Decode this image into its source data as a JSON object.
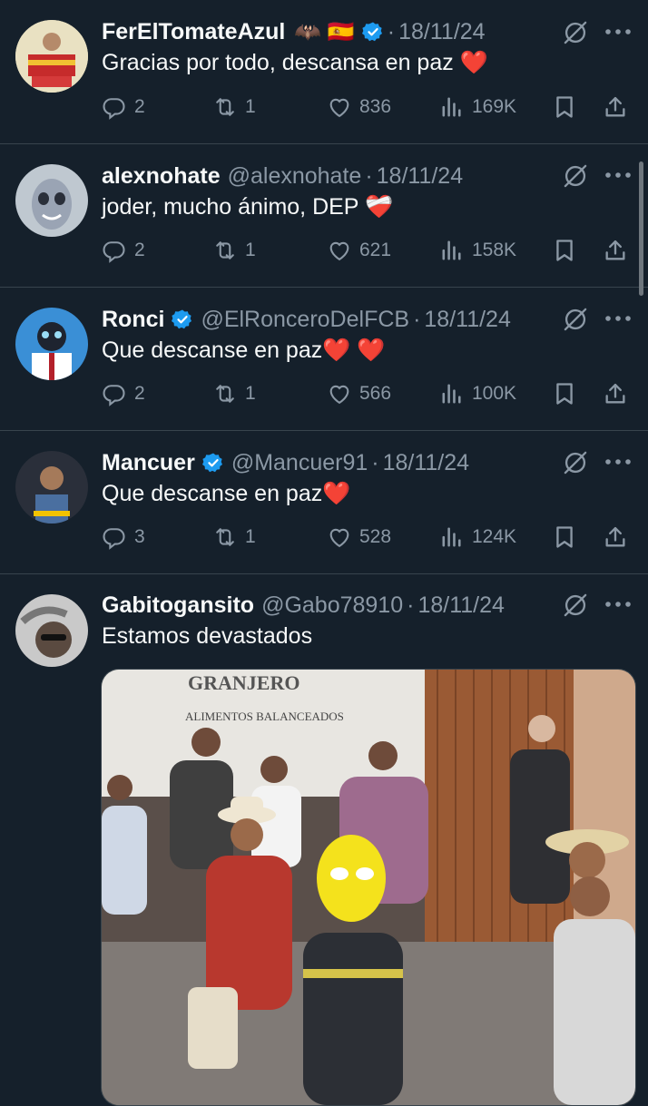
{
  "colors": {
    "background": "#15202b",
    "text": "#f7f9f9",
    "muted": "#8b98a5",
    "verified": "#1d9bf0",
    "divider": "#38444d"
  },
  "tweets": [
    {
      "name": "FerElTomateAzul",
      "emojis": "🦇 🇪🇸",
      "handle": "",
      "date": "18/11/24",
      "text": "Gracias por todo, descansa en paz ❤️",
      "replies": "2",
      "retweets": "1",
      "likes": "836",
      "views": "169K",
      "verified": true
    },
    {
      "name": "alexnohate",
      "handle": "@alexnohate",
      "date": "18/11/24",
      "text": "joder, mucho ánimo, DEP ❤️‍🩹",
      "replies": "2",
      "retweets": "1",
      "likes": "621",
      "views": "158K",
      "verified": false
    },
    {
      "name": "Ronci",
      "handle": "@ElRonceroDelFCB",
      "date": "18/11/24",
      "text": "Que descanse en paz❤️ ❤️",
      "replies": "2",
      "retweets": "1",
      "likes": "566",
      "views": "100K",
      "verified": true
    },
    {
      "name": "Mancuer",
      "handle": "@Mancuer91",
      "date": "18/11/24",
      "text": "Que descanse en paz❤️",
      "replies": "3",
      "retweets": "1",
      "likes": "528",
      "views": "124K",
      "verified": true
    },
    {
      "name": "Gabitogansito",
      "handle": "@Gabo78910",
      "date": "18/11/24",
      "text": "Estamos devastados",
      "verified": false,
      "media_sign_line1": "GRANJERO",
      "media_sign_line2": "ALIMENTOS BALANCEADOS"
    }
  ]
}
